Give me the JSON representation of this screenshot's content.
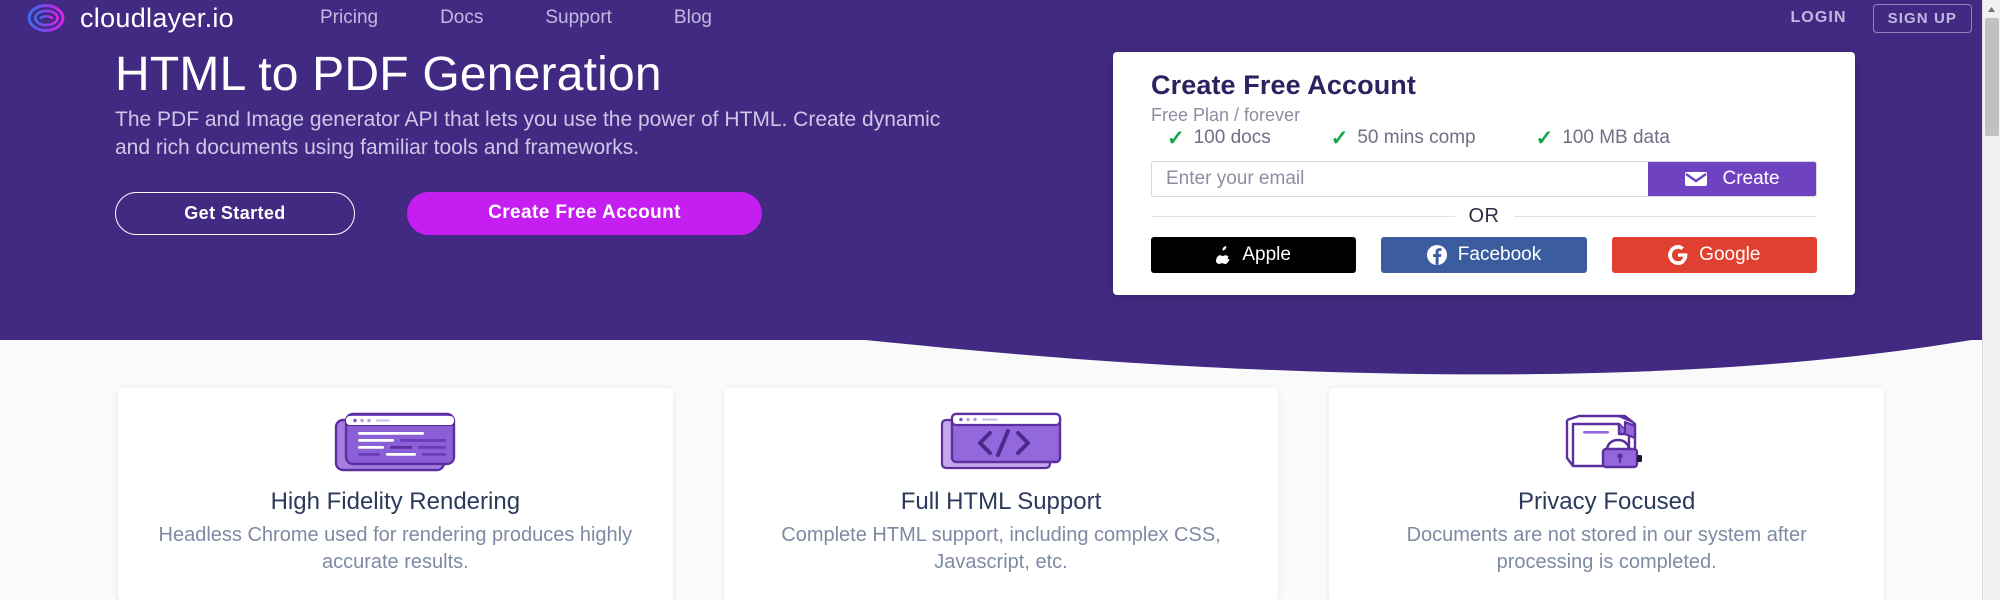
{
  "brand": {
    "name": "cloudlayer.io",
    "logo_icon": "cloudlayer-eye-logo-icon",
    "hero_bg": "#422a83",
    "accent_magenta": "#c41ff0",
    "accent_purple": "#6f42c1"
  },
  "nav": {
    "links": [
      {
        "label": "Pricing"
      },
      {
        "label": "Docs"
      },
      {
        "label": "Support"
      },
      {
        "label": "Blog"
      }
    ],
    "login_label": "LOGIN",
    "signup_label": "SIGN UP"
  },
  "hero": {
    "title": "HTML to PDF Generation",
    "subtitle": "The PDF and Image generator API that lets you use the power of HTML. Create dynamic and rich documents using familiar tools and frameworks.",
    "primary_button": "Get Started",
    "secondary_button": "Create Free Account"
  },
  "signup": {
    "title": "Create Free Account",
    "plan": "Free Plan / forever",
    "features": [
      {
        "label": "100 docs",
        "icon": "check-icon"
      },
      {
        "label": "50 mins comp",
        "icon": "check-icon"
      },
      {
        "label": "100 MB data",
        "icon": "check-icon"
      }
    ],
    "email_placeholder": "Enter your email",
    "email_value": "",
    "create_label": "Create",
    "create_icon": "envelope-icon",
    "divider_label": "OR",
    "social": [
      {
        "label": "Apple",
        "icon": "apple-icon",
        "color": "#000000"
      },
      {
        "label": "Facebook",
        "icon": "facebook-icon",
        "color": "#3b5da0"
      },
      {
        "label": "Google",
        "icon": "google-icon",
        "color": "#e0402f"
      }
    ]
  },
  "features": [
    {
      "icon": "browser-window-code-icon",
      "title": "High Fidelity Rendering",
      "desc": "Headless Chrome used for rendering produces highly accurate results."
    },
    {
      "icon": "code-brackets-window-icon",
      "title": "Full HTML Support",
      "desc": "Complete HTML support, including complex CSS, Javascript, etc."
    },
    {
      "icon": "document-lock-icon",
      "title": "Privacy Focused",
      "desc": "Documents are not stored in our system after processing is completed."
    }
  ]
}
